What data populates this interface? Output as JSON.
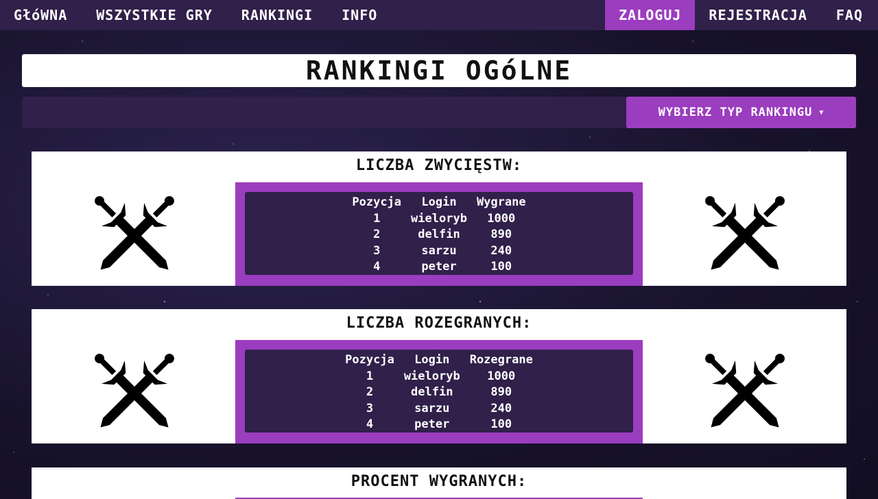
{
  "nav": {
    "home": "GłóWNA",
    "all_games": "WSZYSTKIE GRY",
    "rankings": "RANKINGI",
    "info": "INFO",
    "login": "ZALOGUJ",
    "register": "REJESTRACJA",
    "faq": "FAQ"
  },
  "page_title": "RANKINGI OGóLNE",
  "ranking_type_button": "WYBIERZ TYP RANKINGU",
  "colors": {
    "accent": "#9b3dbf",
    "dark_panel": "#30204a",
    "background": "#1b1531"
  },
  "icons": {
    "swords": "crossed-swords-icon",
    "caret": "caret-down-icon"
  },
  "rankings": [
    {
      "title": "LICZBA ZWYCIĘSTW:",
      "headers": [
        "Pozycja",
        "Login",
        "Wygrane"
      ],
      "rows": [
        [
          "1",
          "wieloryb",
          "1000"
        ],
        [
          "2",
          "delfin",
          "890"
        ],
        [
          "3",
          "sarzu",
          "240"
        ],
        [
          "4",
          "peter",
          "100"
        ]
      ]
    },
    {
      "title": "LICZBA ROZEGRANYCH:",
      "headers": [
        "Pozycja",
        "Login",
        "Rozegrane"
      ],
      "rows": [
        [
          "1",
          "wieloryb",
          "1000"
        ],
        [
          "2",
          "delfin",
          "890"
        ],
        [
          "3",
          "sarzu",
          "240"
        ],
        [
          "4",
          "peter",
          "100"
        ]
      ]
    },
    {
      "title": "PROCENT WYGRANYCH:"
    }
  ]
}
